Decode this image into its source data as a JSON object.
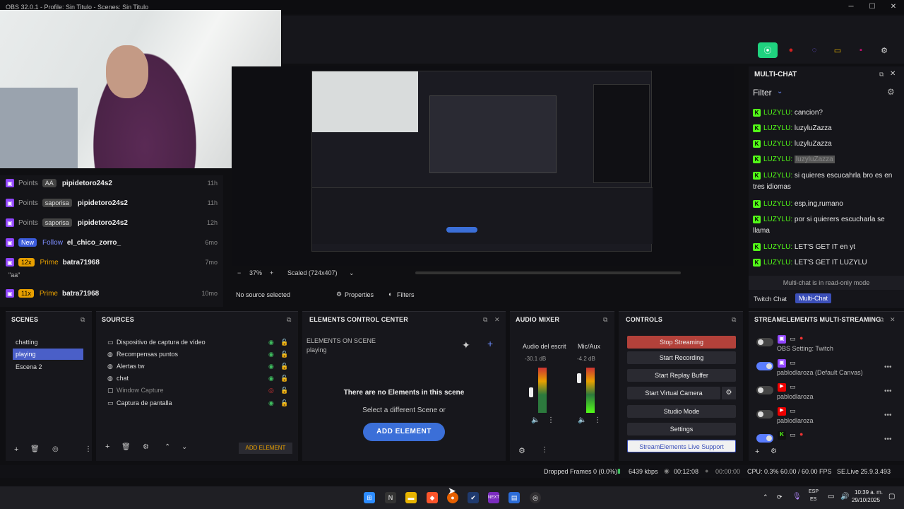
{
  "window": {
    "title": "OBS 32.0.1 - Profile: Sin Titulo - Scenes: Sin Titulo"
  },
  "activity": [
    {
      "tag": "Points",
      "badge": "AA",
      "user": "pipidetoro24s2",
      "time": "11h"
    },
    {
      "tag": "Points",
      "badge": "saporisa",
      "user": "pipidetoro24s2",
      "time": "11h"
    },
    {
      "tag": "Points",
      "badge": "saporisa",
      "user": "pipidetoro24s2",
      "time": "12h"
    },
    {
      "tag": "New",
      "badge": "Follow",
      "user": "el_chico_zorro_",
      "time": "6mo"
    },
    {
      "tag": "12x",
      "badge": "Prime",
      "user": "batra71968",
      "time": "7mo",
      "note": "\"aa\""
    },
    {
      "tag": "11x",
      "badge": "Prime",
      "user": "batra71968",
      "time": "10mo"
    }
  ],
  "preview": {
    "zoom": "37%",
    "scale": "Scaled (724x407)",
    "no_source": "No source selected",
    "properties": "Properties",
    "filters": "Filters"
  },
  "multichat": {
    "title": "MULTI-CHAT",
    "filter": "Filter",
    "readonly": "Multi-chat is in read-only mode",
    "tab_twitch": "Twitch Chat",
    "tab_multi": "Multi-Chat",
    "messages": [
      {
        "name": "LUZYLU:",
        "text": "cancion?"
      },
      {
        "name": "LUZYLU:",
        "text": "luzyluZazza"
      },
      {
        "name": "LUZYLU:",
        "text": "luzyluZazza"
      },
      {
        "name": "LUZYLU:",
        "text": "luzyluZazza"
      },
      {
        "name": "LUZYLU:",
        "text": "si quieres escucahrla bro es en tres idiomas"
      },
      {
        "name": "LUZYLU:",
        "text": "esp,ing,rumano"
      },
      {
        "name": "LUZYLU:",
        "text": "por si quierers escucharla se llama"
      },
      {
        "name": "LUZYLU:",
        "text": "LET'S GET IT en yt"
      },
      {
        "name": "LUZYLU:",
        "text": "LET'S GET IT LUZYLU"
      }
    ]
  },
  "scenes": {
    "title": "SCENES",
    "items": [
      "chatting",
      "playing",
      "Escena 2"
    ]
  },
  "sources": {
    "title": "SOURCES",
    "add": "ADD ELEMENT",
    "items": [
      {
        "icon": "camera-icon",
        "label": "Dispositivo de captura de vídeo"
      },
      {
        "icon": "globe-icon",
        "label": "Recompensas puntos"
      },
      {
        "icon": "globe-icon",
        "label": "Alertas tw"
      },
      {
        "icon": "globe-icon",
        "label": "chat"
      },
      {
        "icon": "window-icon",
        "label": "Window Capture"
      },
      {
        "icon": "monitor-icon",
        "label": "Captura de pantalla"
      }
    ]
  },
  "elements": {
    "title": "ELEMENTS CONTROL CENTER",
    "on_scene": "ELEMENTS ON SCENE",
    "scene": "playing",
    "empty": "There are no Elements in this scene",
    "hint": "Select a different Scene or",
    "add": "ADD ELEMENT"
  },
  "audio": {
    "title": "AUDIO MIXER",
    "ch1": "Audio del escrit",
    "ch1_db": "-30.1 dB",
    "ch2": "Mic/Aux",
    "ch2_db": "-4.2 dB"
  },
  "controls": {
    "title": "CONTROLS",
    "stop": "Stop Streaming",
    "rec": "Start Recording",
    "replay": "Start Replay Buffer",
    "vcam": "Start Virtual Camera",
    "studio": "Studio Mode",
    "settings": "Settings",
    "support": "StreamElements Live Support"
  },
  "se": {
    "title": "STREAMELEMENTS MULTI-STREAMING",
    "rows": [
      {
        "label": "OBS Setting: Twitch",
        "on": false
      },
      {
        "label": "pablodlaroza (Default Canvas)",
        "on": true
      },
      {
        "label": "pablodlaroza",
        "on": false
      },
      {
        "label": "pablodlaroza",
        "on": false
      },
      {
        "label": "",
        "on": true
      }
    ]
  },
  "status": {
    "dropped": "Dropped Frames 0 (0.0%)",
    "kbps": "6439 kbps",
    "t1": "00:12:08",
    "t2": "00:00:00",
    "cpu": "CPU: 0.3%",
    "fps": "60.00 / 60.00 FPS",
    "se": "SE.Live 25.9.3.493"
  },
  "taskbar": {
    "time": "10:39 a. m.",
    "date": "29/10/2025",
    "lang": "ESP",
    "lang2": "ES"
  },
  "colors": {
    "accent": "#5a7dff",
    "stop": "#b3413a",
    "kick": "#53fc18",
    "twitch": "#9146ff"
  }
}
